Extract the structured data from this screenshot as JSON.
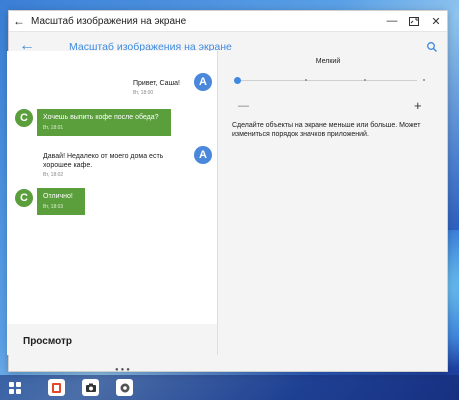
{
  "window": {
    "title": "Масштаб изображения на экране"
  },
  "appbar": {
    "title": "Масштаб изображения на экране"
  },
  "chat": {
    "messages": [
      {
        "avatar": "A",
        "text": "Привет, Саша!",
        "time": "Вт, 18:00"
      },
      {
        "avatar": "C",
        "text": "Хочешь выпить кофе после обеда?",
        "time": "Вт, 18:01"
      },
      {
        "avatar": "A",
        "text": "Давай! Недалеко от моего дома есть хорошее кафе.",
        "time": "Вт, 18:02"
      },
      {
        "avatar": "C",
        "text": "Отлично!",
        "time": "Вт, 18:03"
      }
    ]
  },
  "preview": {
    "label": "Просмотр"
  },
  "scale": {
    "current_label": "Мелкий",
    "level": 0,
    "steps": 4,
    "minus": "—",
    "plus": "+",
    "description": "Сделайте объекты на экране меньше или больше. Может измениться порядок значков приложений."
  },
  "colors": {
    "accent": "#3f8ae0",
    "avatar_a": "#4b88dc",
    "avatar_c": "#5b9e3c",
    "bubble_green": "#5b9e3c"
  },
  "taskbar": {
    "icons": [
      "apps-icon",
      "office-icon",
      "camera-icon",
      "settings-icon"
    ]
  }
}
